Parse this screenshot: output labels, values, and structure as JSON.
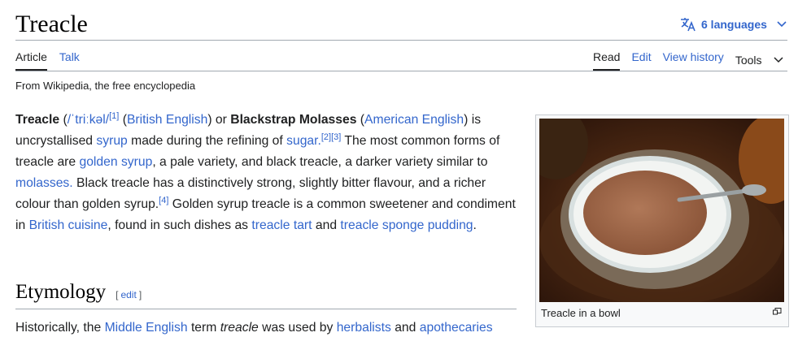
{
  "article": {
    "title": "Treacle",
    "languages_label": "6 languages",
    "tagline": "From Wikipedia, the free encyclopedia"
  },
  "tabs_left": [
    "Article",
    "Talk"
  ],
  "tabs_right": [
    "Read",
    "Edit",
    "View history"
  ],
  "tools_label": "Tools",
  "lead": {
    "t1": "Treacle",
    "ipa_open": " (",
    "ipa": "/ˈtriːkəl/",
    "ref1": "[1]",
    "t2": " (",
    "british_english": "British English",
    "t3": ") or ",
    "blackstrap": "Blackstrap Molasses",
    "t4": " (",
    "american_english": "American English",
    "t5": ") is uncrystallised ",
    "syrup": "syrup",
    "t6": " made during the refining of ",
    "sugar": "sugar.",
    "ref2": "[2]",
    "ref3": "[3]",
    "t7": " The most common forms of treacle are ",
    "golden_syrup": "golden syrup",
    "t8": ", a pale variety, and black treacle, a darker variety similar to ",
    "molasses": "molasses.",
    "t9": " Black treacle has a distinctively strong, slightly bitter flavour, and a richer colour than golden syrup.",
    "ref4": "[4]",
    "t10": " Golden syrup treacle is a common sweetener and condiment in ",
    "british_cuisine": "British cuisine",
    "t11": ", found in such dishes as ",
    "treacle_tart": "treacle tart",
    "t12": " and ",
    "treacle_sponge": "treacle sponge pudding",
    "t13": "."
  },
  "infobox": {
    "caption": "Treacle in a bowl"
  },
  "etymology": {
    "heading": "Etymology",
    "edit_open": "[",
    "edit_label": "edit",
    "edit_close": "]",
    "p1": "Historically, the ",
    "middle_english": "Middle English",
    "p2": " term ",
    "treacle_italic": "treacle",
    "p3": " was used by ",
    "herbalists": "herbalists",
    "p4": " and ",
    "apothecaries": "apothecaries"
  },
  "icons": {
    "language": "translate-icon",
    "chevron": "chevron-down-icon",
    "magnify": "magnify-icon"
  },
  "colors": {
    "link": "#3366cc",
    "text": "#202122",
    "rule": "#a2a9b1"
  }
}
